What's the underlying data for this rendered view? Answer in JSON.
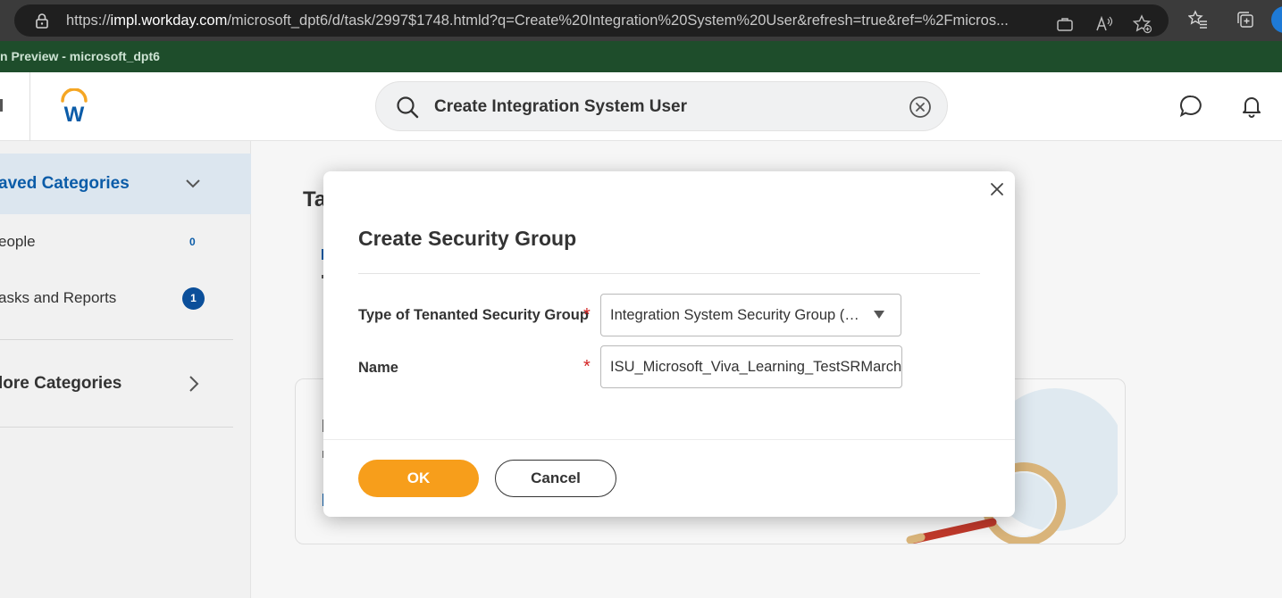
{
  "browser": {
    "url_prefix": "https://",
    "url_host": "impl.workday.com",
    "url_rest": "/microsoft_dpt6/d/task/2997$1748.htmld?q=Create%20Integration%20System%20User&refresh=true&ref=%2Fmicros..."
  },
  "banner": {
    "text": "n Preview - microsoft_dpt6"
  },
  "header": {
    "search_value": "Create Integration System User",
    "logo_letter": "W"
  },
  "sidebar": {
    "saved_categories": "aved Categories",
    "items": [
      {
        "label": "eople",
        "count": "0"
      },
      {
        "label": "asks and Reports",
        "count": "1"
      }
    ],
    "more_categories": "lore Categories"
  },
  "main": {
    "title_fragment": "Ta"
  },
  "modal": {
    "title": "Create Security Group",
    "type_label": "Type of Tenanted Security Group",
    "type_required": "*",
    "type_value": "Integration System Security Group (Unconstrained)",
    "name_label": "Name",
    "name_required": "*",
    "name_value": "ISU_Microsoft_Viva_Learning_TestSRMarch",
    "ok_label": "OK",
    "cancel_label": "Cancel"
  },
  "colors": {
    "accent_orange": "#f79e1b",
    "link_blue": "#0b5ca8",
    "banner_green": "#1e4d2b",
    "required_red": "#d32222"
  }
}
